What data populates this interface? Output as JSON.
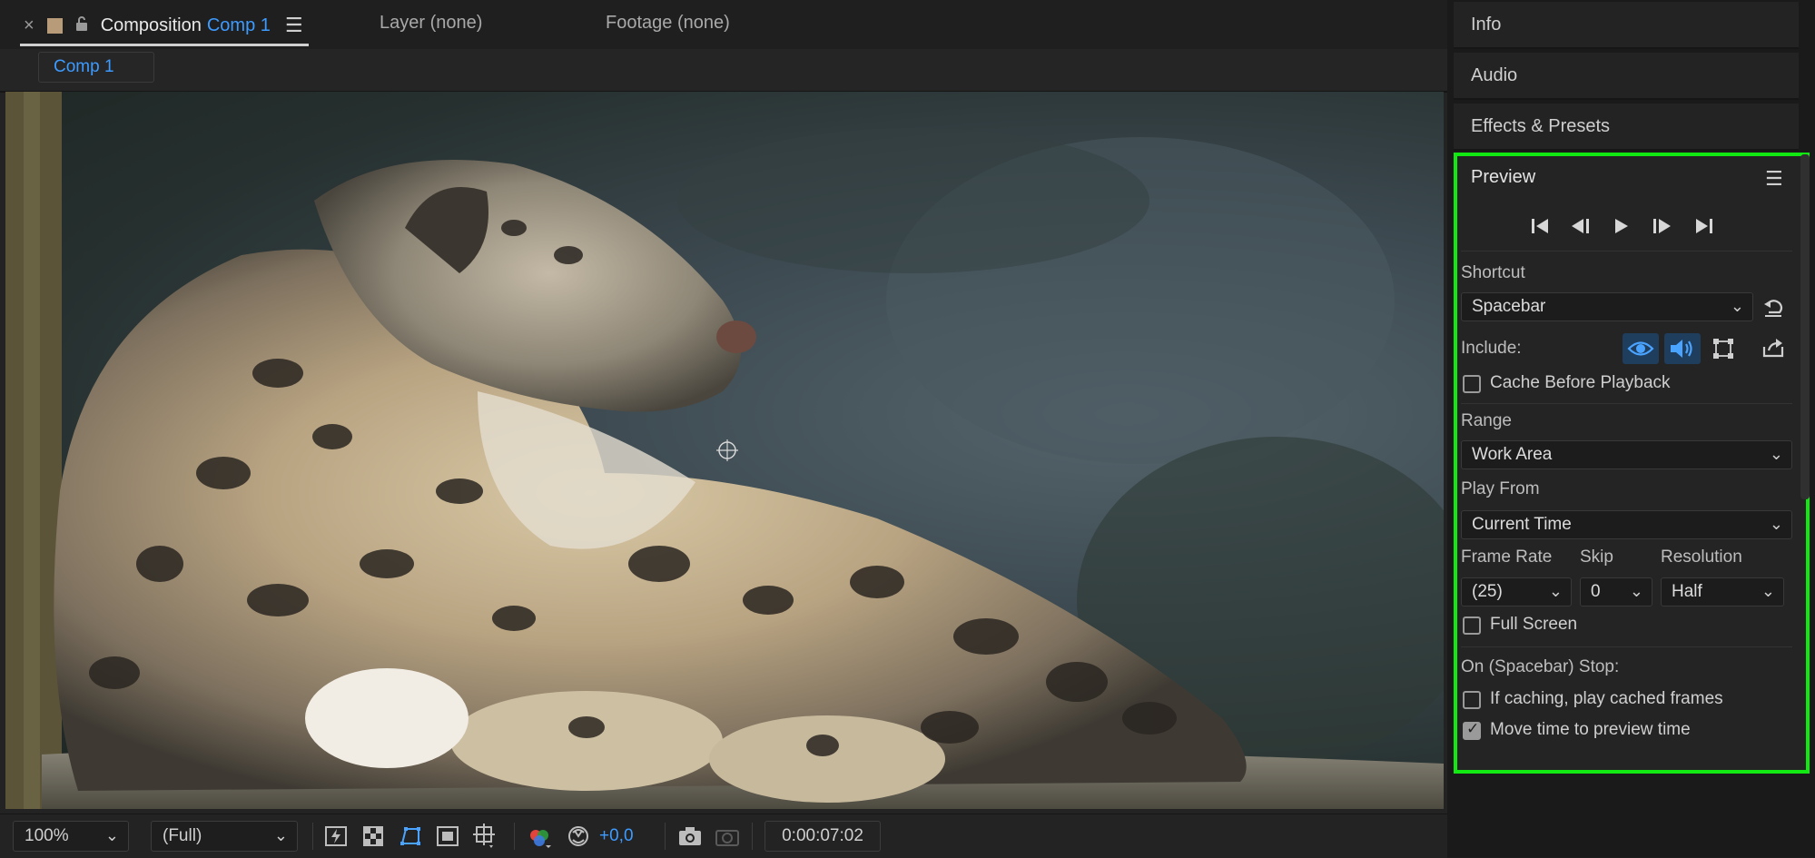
{
  "composition_panel": {
    "tab": {
      "close": "×",
      "title": "Composition",
      "comp_name": "Comp 1",
      "menu": "☰"
    },
    "layer_tab": "Layer (none)",
    "footage_tab": "Footage (none)",
    "comp_chip": "Comp 1"
  },
  "viewer_toolbar": {
    "zoom": "100%",
    "resolution": "(Full)",
    "exposure": "+0,0",
    "timecode": "0:00:07:02"
  },
  "right_panels": {
    "info": "Info",
    "audio": "Audio",
    "effects_presets": "Effects & Presets"
  },
  "preview": {
    "title": "Preview",
    "menu": "☰",
    "shortcut_label": "Shortcut",
    "shortcut_value": "Spacebar",
    "include_label": "Include:",
    "include": {
      "video": true,
      "audio": true,
      "overlays": false
    },
    "cache_before_playback": {
      "label": "Cache Before Playback",
      "checked": false
    },
    "range_label": "Range",
    "range_value": "Work Area",
    "play_from_label": "Play From",
    "play_from_value": "Current Time",
    "frame_rate_label": "Frame Rate",
    "frame_rate_value": "(25)",
    "skip_label": "Skip",
    "skip_value": "0",
    "resolution_label": "Resolution",
    "resolution_value": "Half",
    "full_screen": {
      "label": "Full Screen",
      "checked": false
    },
    "on_stop_label": "On (Spacebar) Stop:",
    "if_caching": {
      "label": "If caching, play cached frames",
      "checked": false
    },
    "move_time": {
      "label": "Move time to preview time",
      "checked": true
    }
  },
  "colors": {
    "accent_blue": "#3d9bff",
    "highlight_green": "#12e812",
    "panel_bg": "#242424"
  },
  "icons": {
    "first_frame": "first-frame-icon",
    "prev_frame": "prev-frame-icon",
    "play": "play-icon",
    "next_frame": "next-frame-icon",
    "last_frame": "last-frame-icon",
    "reset": "reset-icon",
    "export": "export-icon"
  }
}
